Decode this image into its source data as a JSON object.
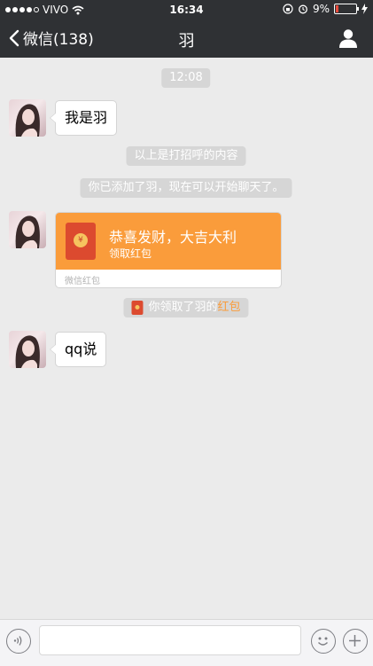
{
  "status_bar": {
    "carrier": "VIVO",
    "time": "16:34",
    "battery": "9%"
  },
  "nav": {
    "back_label": "微信(138)",
    "title": "羽"
  },
  "chat": {
    "time_label": "12:08",
    "messages": [
      {
        "text": "我是羽"
      },
      {
        "text": "qq说"
      }
    ],
    "system_notices": [
      "以上是打招呼的内容",
      "你已添加了羽，现在可以开始聊天了。"
    ],
    "red_packet": {
      "title": "恭喜发财，大吉大利",
      "subtitle": "领取红包",
      "footer": "微信红包"
    },
    "received_notice": {
      "prefix": "你领取了羽的",
      "link": "红包"
    }
  },
  "input": {
    "placeholder": ""
  },
  "colors": {
    "nav_bg": "#2f3134",
    "chat_bg": "#ebebeb",
    "red_packet": "#fa9c3b",
    "packet_icon": "#dc4a2f"
  }
}
